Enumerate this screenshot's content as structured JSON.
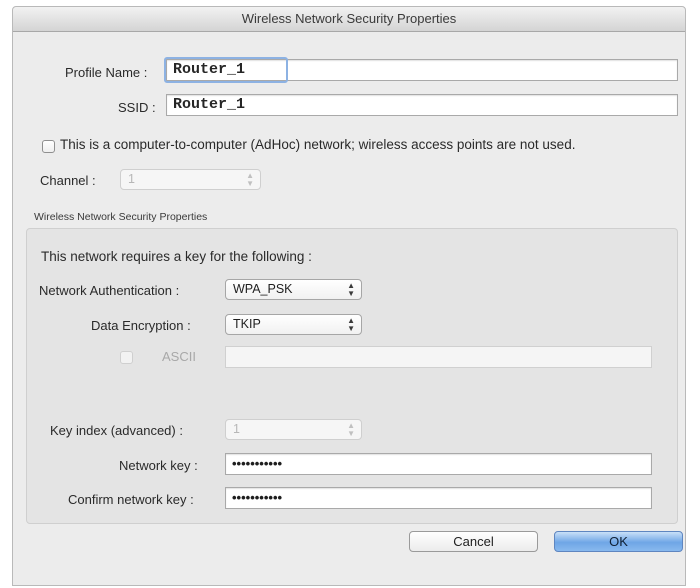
{
  "window": {
    "title": "Wireless Network Security Properties"
  },
  "profile": {
    "name_label": "Profile Name :",
    "name_value": "Router_1",
    "ssid_label": "SSID :",
    "ssid_value": "Router_1"
  },
  "adhoc": {
    "checkbox_label": "This is a computer-to-computer (AdHoc) network; wireless access points are not used.",
    "checked": false
  },
  "channel": {
    "label": "Channel :",
    "value": "1"
  },
  "security_group": {
    "caption": "Wireless Network Security Properties",
    "intro": "This network requires a key for the following :",
    "auth_label": "Network Authentication :",
    "auth_value": "WPA_PSK",
    "encryption_label": "Data Encryption :",
    "encryption_value": "TKIP",
    "ascii_label": "ASCII",
    "ascii_value": "",
    "key_index_label": "Key index (advanced) :",
    "key_index_value": "1",
    "network_key_label": "Network key :",
    "network_key_value": "•••••••••••",
    "confirm_key_label": "Confirm network key :",
    "confirm_key_value": "•••••••••••"
  },
  "buttons": {
    "cancel": "Cancel",
    "ok": "OK"
  },
  "colors": {
    "window_bg": "#ececec",
    "group_bg": "#e4e4e4",
    "focus_ring": "#8db2e3",
    "default_button": "#6fa6e6"
  },
  "icons": {
    "select_arrows": "up-down-chevron-icon"
  }
}
